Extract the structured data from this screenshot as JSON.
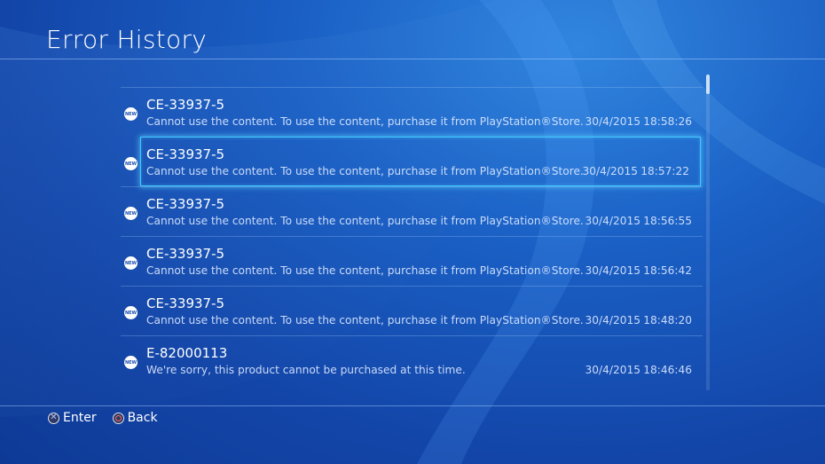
{
  "header": {
    "title": "Error History"
  },
  "errors": [
    {
      "badge": "NEW",
      "code": "CE-33937-5",
      "message": "Cannot use the content. To use the content, purchase it from PlayStation®Store.",
      "date": "30/4/2015",
      "time": "18:58:26"
    },
    {
      "badge": "NEW",
      "code": "CE-33937-5",
      "message": "Cannot use the content. To use the content, purchase it from PlayStation®Store.",
      "date": "30/4/2015",
      "time": "18:57:22"
    },
    {
      "badge": "NEW",
      "code": "CE-33937-5",
      "message": "Cannot use the content. To use the content, purchase it from PlayStation®Store.",
      "date": "30/4/2015",
      "time": "18:56:55"
    },
    {
      "badge": "NEW",
      "code": "CE-33937-5",
      "message": "Cannot use the content. To use the content, purchase it from PlayStation®Store.",
      "date": "30/4/2015",
      "time": "18:56:42"
    },
    {
      "badge": "NEW",
      "code": "CE-33937-5",
      "message": "Cannot use the content. To use the content, purchase it from PlayStation®Store.",
      "date": "30/4/2015",
      "time": "18:48:20"
    },
    {
      "badge": "NEW",
      "code": "E-82000113",
      "message": "We're sorry, this product cannot be purchased at this time.",
      "date": "30/4/2015",
      "time": "18:46:46"
    }
  ],
  "footer": {
    "enter_label": "Enter",
    "back_label": "Back",
    "enter_icon": "cross-icon",
    "back_icon": "circle-icon"
  },
  "colors": {
    "background": "#1a5fc4",
    "selection": "#3fc8ff"
  }
}
